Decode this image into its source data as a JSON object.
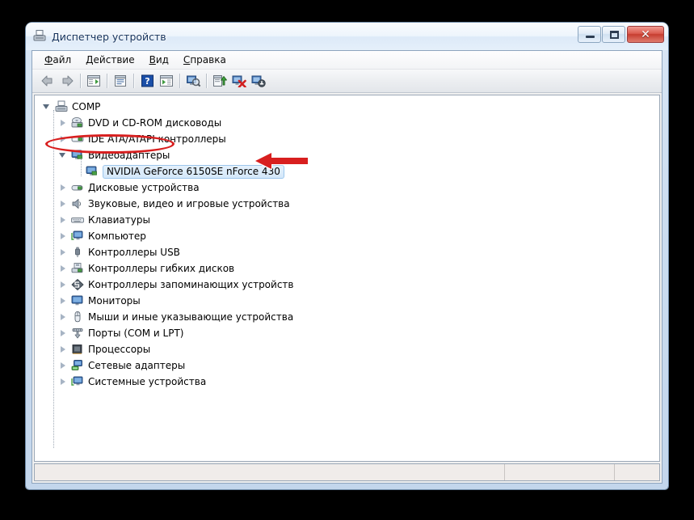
{
  "window": {
    "title": "Диспетчер устройств",
    "title_icon": "device-manager-icon",
    "buttons": {
      "minimize": "minimize-button",
      "maximize": "maximize-button",
      "close_label": "✕"
    }
  },
  "menu": {
    "items": [
      {
        "name": "file",
        "accel": "Ф",
        "rest": "айл"
      },
      {
        "name": "action",
        "accel": "Д",
        "rest": "ействие"
      },
      {
        "name": "view",
        "accel": "В",
        "rest": "ид"
      },
      {
        "name": "help",
        "accel": "С",
        "rest": "правка"
      }
    ]
  },
  "toolbar": {
    "buttons": [
      {
        "name": "back-button",
        "icon": "arrow-left-icon"
      },
      {
        "name": "forward-button",
        "icon": "arrow-right-icon"
      },
      {
        "name": "show-hide-console-tree-button",
        "icon": "console-tree-icon"
      },
      {
        "name": "properties-button",
        "icon": "properties-icon"
      },
      {
        "name": "help-button",
        "icon": "question-mark-icon"
      },
      {
        "name": "show-hide-action-pane-button",
        "icon": "action-pane-icon"
      },
      {
        "name": "scan-hardware-changes-button",
        "icon": "magnifier-scan-icon"
      },
      {
        "name": "update-driver-button",
        "icon": "update-driver-icon"
      },
      {
        "name": "uninstall-device-button",
        "icon": "uninstall-red-x-icon"
      },
      {
        "name": "disable-device-button",
        "icon": "disable-device-icon"
      }
    ]
  },
  "tree": {
    "root": {
      "label": "COMP",
      "icon": "computer-icon",
      "expanded": true
    },
    "nodes": [
      {
        "label": "DVD и CD-ROM дисководы",
        "icon": "dvd-drive-icon",
        "expanded": false,
        "selected": false
      },
      {
        "label": "IDE ATA/ATAPI контроллеры",
        "icon": "ide-controller-icon",
        "expanded": false,
        "selected": false
      },
      {
        "label": "Видеоадаптеры",
        "icon": "display-adapter-icon",
        "expanded": true,
        "selected": false,
        "highlighted": true
      },
      {
        "label": "NVIDIA GeForce 6150SE nForce 430",
        "icon": "display-adapter-icon",
        "expanded": false,
        "selected": true,
        "child": true
      },
      {
        "label": "Дисковые устройства",
        "icon": "disk-drive-icon",
        "expanded": false,
        "selected": false
      },
      {
        "label": "Звуковые, видео и игровые устройства",
        "icon": "sound-device-icon",
        "expanded": false,
        "selected": false
      },
      {
        "label": "Клавиатуры",
        "icon": "keyboard-icon",
        "expanded": false,
        "selected": false
      },
      {
        "label": "Компьютер",
        "icon": "computer-node-icon",
        "expanded": false,
        "selected": false
      },
      {
        "label": "Контроллеры USB",
        "icon": "usb-controller-icon",
        "expanded": false,
        "selected": false
      },
      {
        "label": "Контроллеры гибких дисков",
        "icon": "floppy-controller-icon",
        "expanded": false,
        "selected": false
      },
      {
        "label": "Контроллеры запоминающих устройств",
        "icon": "storage-controller-icon",
        "expanded": false,
        "selected": false
      },
      {
        "label": "Мониторы",
        "icon": "monitor-icon",
        "expanded": false,
        "selected": false
      },
      {
        "label": "Мыши и иные указывающие устройства",
        "icon": "mouse-icon",
        "expanded": false,
        "selected": false
      },
      {
        "label": "Порты (COM и LPT)",
        "icon": "ports-icon",
        "expanded": false,
        "selected": false
      },
      {
        "label": "Процессоры",
        "icon": "processor-icon",
        "expanded": false,
        "selected": false
      },
      {
        "label": "Сетевые адаптеры",
        "icon": "network-adapter-icon",
        "expanded": false,
        "selected": false
      },
      {
        "label": "Системные устройства",
        "icon": "system-device-icon",
        "expanded": false,
        "selected": false
      }
    ]
  },
  "statusbar": {
    "main_text": "",
    "pane1_text": "",
    "pane2_text": ""
  },
  "annotations": {
    "ellipse": {
      "name": "highlight-ellipse",
      "target": "Видеоадаптеры",
      "color": "#d81f1f"
    },
    "arrow": {
      "name": "pointer-arrow",
      "target": "NVIDIA GeForce 6150SE nForce 430",
      "direction": "left",
      "color": "#d81f1f"
    }
  },
  "colors": {
    "accent_red": "#d81f1f",
    "selection_blue": "#9cc6ec",
    "title_text": "#16335c"
  }
}
